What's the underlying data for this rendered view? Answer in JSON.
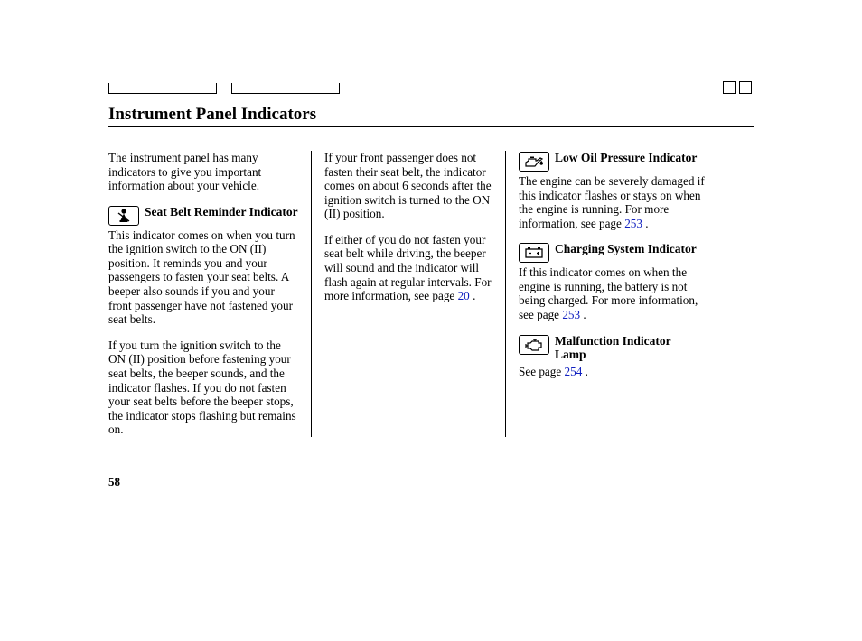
{
  "title": "Instrument Panel Indicators",
  "page_number": "58",
  "col1": {
    "intro": "The instrument panel has many indicators to give you important information about your vehicle.",
    "seatbelt_title": "Seat Belt Reminder Indicator",
    "seatbelt_p1": "This indicator comes on when you turn the ignition switch to the ON (II) position. It reminds you and your passengers to fasten your seat belts. A beeper also sounds if you and your front passenger have not fastened your seat belts.",
    "seatbelt_p2": "If you turn the ignition switch to the ON (II) position before fastening your seat belts, the beeper sounds, and the indicator flashes. If you do not fasten your seat belts before the beeper stops, the indicator stops flashing but remains on."
  },
  "col2": {
    "p1": "If your front passenger does not fasten their seat belt, the indicator comes on about 6 seconds after the ignition switch is turned to the ON (II) position.",
    "p2a": "If either of you do not fasten your seat belt while driving, the beeper will sound and the indicator will flash again at regular intervals. For more information, see page ",
    "p2_link": "20",
    "p2b": " ."
  },
  "col3": {
    "oil_title": "Low Oil Pressure Indicator",
    "oil_body_a": "The engine can be severely damaged if this indicator flashes or stays on when the engine is running. For more information, see page ",
    "oil_link": "253",
    "oil_body_b": " .",
    "chg_title": "Charging System Indicator",
    "chg_body_a": "If this indicator comes on when the engine is running, the battery is not being charged. For more information, see page ",
    "chg_link": "253",
    "chg_body_b": " .",
    "mil_title": "Malfunction Indicator Lamp",
    "mil_body_a": "See page ",
    "mil_link": "254",
    "mil_body_b": " ."
  }
}
